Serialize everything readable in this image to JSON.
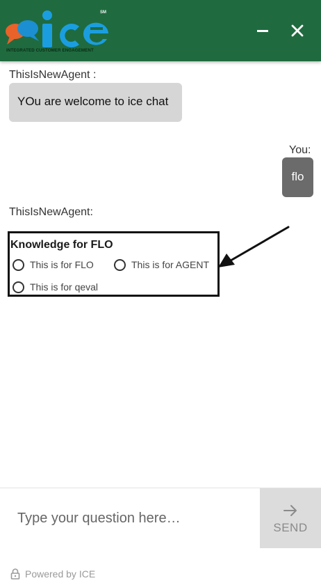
{
  "header": {
    "logo_text": "ice",
    "logo_tagline": "INTEGRATED CUSTOMER ENGAGEMENT",
    "logo_mark": "SM",
    "bg_color": "#1f6b3f",
    "minimize_icon": "minimize-icon",
    "close_icon": "close-icon"
  },
  "messages": [
    {
      "sender": "ThisIsNewAgent :",
      "text": "YOu are welcome to ice chat"
    },
    {
      "sender": "You:",
      "text": "flo"
    }
  ],
  "knowledge": {
    "sender": "ThisIsNewAgent:",
    "title": "Knowledge for FLO",
    "options": [
      "This is for FLO",
      "This is for AGENT",
      "This is for qeval"
    ]
  },
  "input": {
    "placeholder": "Type your question here…",
    "send_label": "SEND"
  },
  "footer": {
    "text": "Powered by ICE",
    "icon": "lock-icon"
  }
}
